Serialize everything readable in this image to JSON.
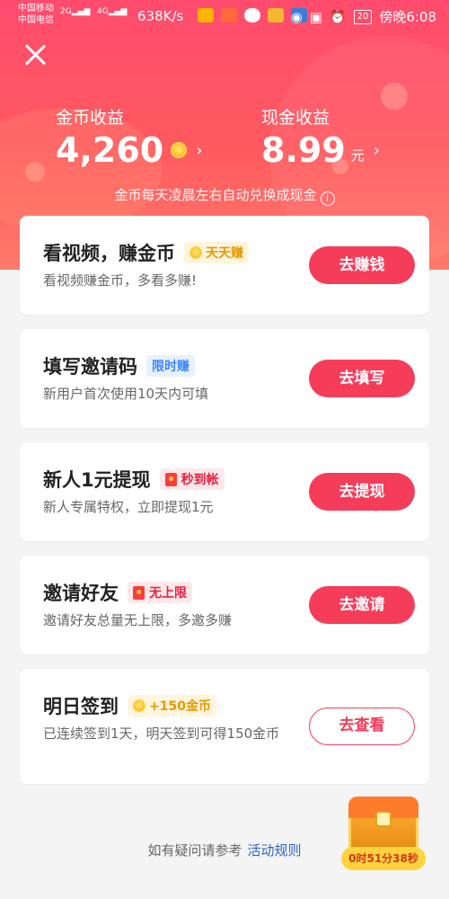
{
  "status_bar": {
    "carrier1": "中国移动",
    "carrier2": "中国电信",
    "net1": "2G",
    "net2": "4G",
    "speed": "638K/s",
    "battery": "20",
    "time": "傍晚6:08"
  },
  "earnings": {
    "coin_label": "金币收益",
    "coin_amount": "4,260",
    "cash_label": "现金收益",
    "cash_amount": "8.99",
    "cash_unit": "元",
    "note": "金币每天凌晨左右自动兑换成现金"
  },
  "tasks": [
    {
      "title": "看视频，赚金币",
      "badge": "天天赚",
      "badge_style": "gold",
      "desc": "看视频赚金币，多看多赚!",
      "button": "去赚钱"
    },
    {
      "title": "填写邀请码",
      "badge": "限时赚",
      "badge_style": "blue",
      "desc": "新用户首次使用10天内可填",
      "button": "去填写"
    },
    {
      "title": "新人1元提现",
      "badge": "秒到帐",
      "badge_style": "red",
      "desc": "新人专属特权，立即提现1元",
      "button": "去提现"
    },
    {
      "title": "邀请好友",
      "badge": "无上限",
      "badge_style": "red",
      "desc": "邀请好友总量无上限，多邀多赚",
      "button": "去邀请"
    },
    {
      "title": "明日签到",
      "badge": "+150金币",
      "badge_style": "gold",
      "desc": "已连续签到1天，明天签到可得150金币",
      "button": "去查看"
    }
  ],
  "footer": {
    "text": "如有疑问请参考",
    "link": "活动规则"
  },
  "chest": {
    "timer": "0时51分38秒"
  },
  "colors": {
    "accent": "#f53d5a",
    "header_top": "#ff4b6e",
    "header_bottom": "#ff7a6b",
    "link": "#2b64c9"
  }
}
